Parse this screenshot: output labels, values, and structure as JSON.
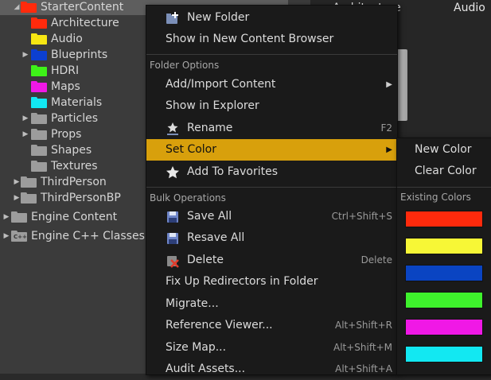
{
  "tree": {
    "items": [
      {
        "label": "StarterContent",
        "color": "#ff2a0c",
        "arrow": "expanded",
        "selected": true
      },
      {
        "label": "Architecture",
        "color": "#ff2a0c",
        "arrow": "none"
      },
      {
        "label": "Audio",
        "color": "#f7e612",
        "arrow": "none"
      },
      {
        "label": "Blueprints",
        "color": "#0c3fd0",
        "arrow": "collapsed"
      },
      {
        "label": "HDRI",
        "color": "#3ef218",
        "arrow": "none"
      },
      {
        "label": "Maps",
        "color": "#f018e6",
        "arrow": "none"
      },
      {
        "label": "Materials",
        "color": "#12e8f2",
        "arrow": "none"
      },
      {
        "label": "Particles",
        "color": "#9c9c9c",
        "arrow": "collapsed"
      },
      {
        "label": "Props",
        "color": "#9c9c9c",
        "arrow": "collapsed"
      },
      {
        "label": "Shapes",
        "color": "#9c9c9c",
        "arrow": "none"
      },
      {
        "label": "Textures",
        "color": "#9c9c9c",
        "arrow": "none"
      },
      {
        "label": "ThirdPerson",
        "color": "#9c9c9c",
        "arrow": "collapsed"
      },
      {
        "label": "ThirdPersonBP",
        "color": "#9c9c9c",
        "arrow": "collapsed"
      },
      {
        "label": "Engine Content",
        "color": "#9c9c9c",
        "arrow": "collapsed"
      },
      {
        "label": "Engine C++ Classes",
        "color": "#9c9c9c",
        "arrow": "collapsed",
        "badge": "C++"
      }
    ]
  },
  "preview": {
    "col1": "Architecture",
    "col2": "Audio"
  },
  "menu": {
    "new_folder": "New Folder",
    "show_in_new_browser": "Show in New Content Browser",
    "section_folder_options": "Folder Options",
    "add_import": "Add/Import Content",
    "show_in_explorer": "Show in Explorer",
    "rename": "Rename",
    "rename_shortcut": "F2",
    "set_color": "Set Color",
    "add_to_favorites": "Add To Favorites",
    "section_bulk": "Bulk Operations",
    "save_all": "Save All",
    "save_all_shortcut": "Ctrl+Shift+S",
    "resave_all": "Resave All",
    "delete": "Delete",
    "delete_shortcut": "Delete",
    "fix_up_redirectors": "Fix Up Redirectors in Folder",
    "migrate": "Migrate...",
    "reference_viewer": "Reference Viewer...",
    "reference_viewer_shortcut": "Alt+Shift+R",
    "size_map": "Size Map...",
    "size_map_shortcut": "Alt+Shift+M",
    "audit_assets": "Audit Assets...",
    "audit_assets_shortcut": "Alt+Shift+A"
  },
  "submenu": {
    "new_color": "New Color",
    "clear_color": "Clear Color",
    "existing_colors_header": "Existing Colors",
    "swatches": [
      "#ff2a0c",
      "#f7f736",
      "#0a44c2",
      "#3ef22c",
      "#f018e6",
      "#12e8f2"
    ]
  },
  "colors": {
    "highlight": "#d8a00c",
    "menu_bg": "#1a1a1a",
    "tree_bg": "#3b3b3b"
  }
}
